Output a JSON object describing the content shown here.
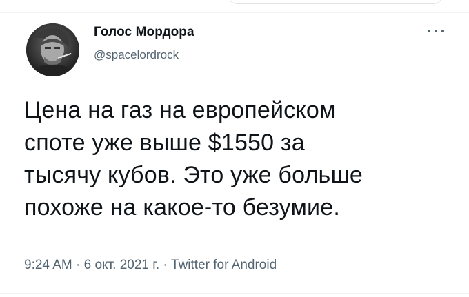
{
  "author": {
    "display_name": "Голос Мордора",
    "handle": "@spacelordrock"
  },
  "tweet": {
    "lines": [
      "Цена на газ на европейском",
      "споте уже выше $1550 за",
      "тысячу кубов. Это уже больше",
      "похоже на какое-то безумие."
    ]
  },
  "meta": {
    "time": "9:24 AM",
    "separator": "·",
    "date": "6 окт. 2021 г.",
    "source": "Twitter for Android"
  },
  "icons": {
    "more": "more-horizontal-icon",
    "avatar": "user-avatar-photo"
  },
  "colors": {
    "text_primary": "#0f1419",
    "text_secondary": "#536471",
    "divider": "#eff3f4"
  }
}
